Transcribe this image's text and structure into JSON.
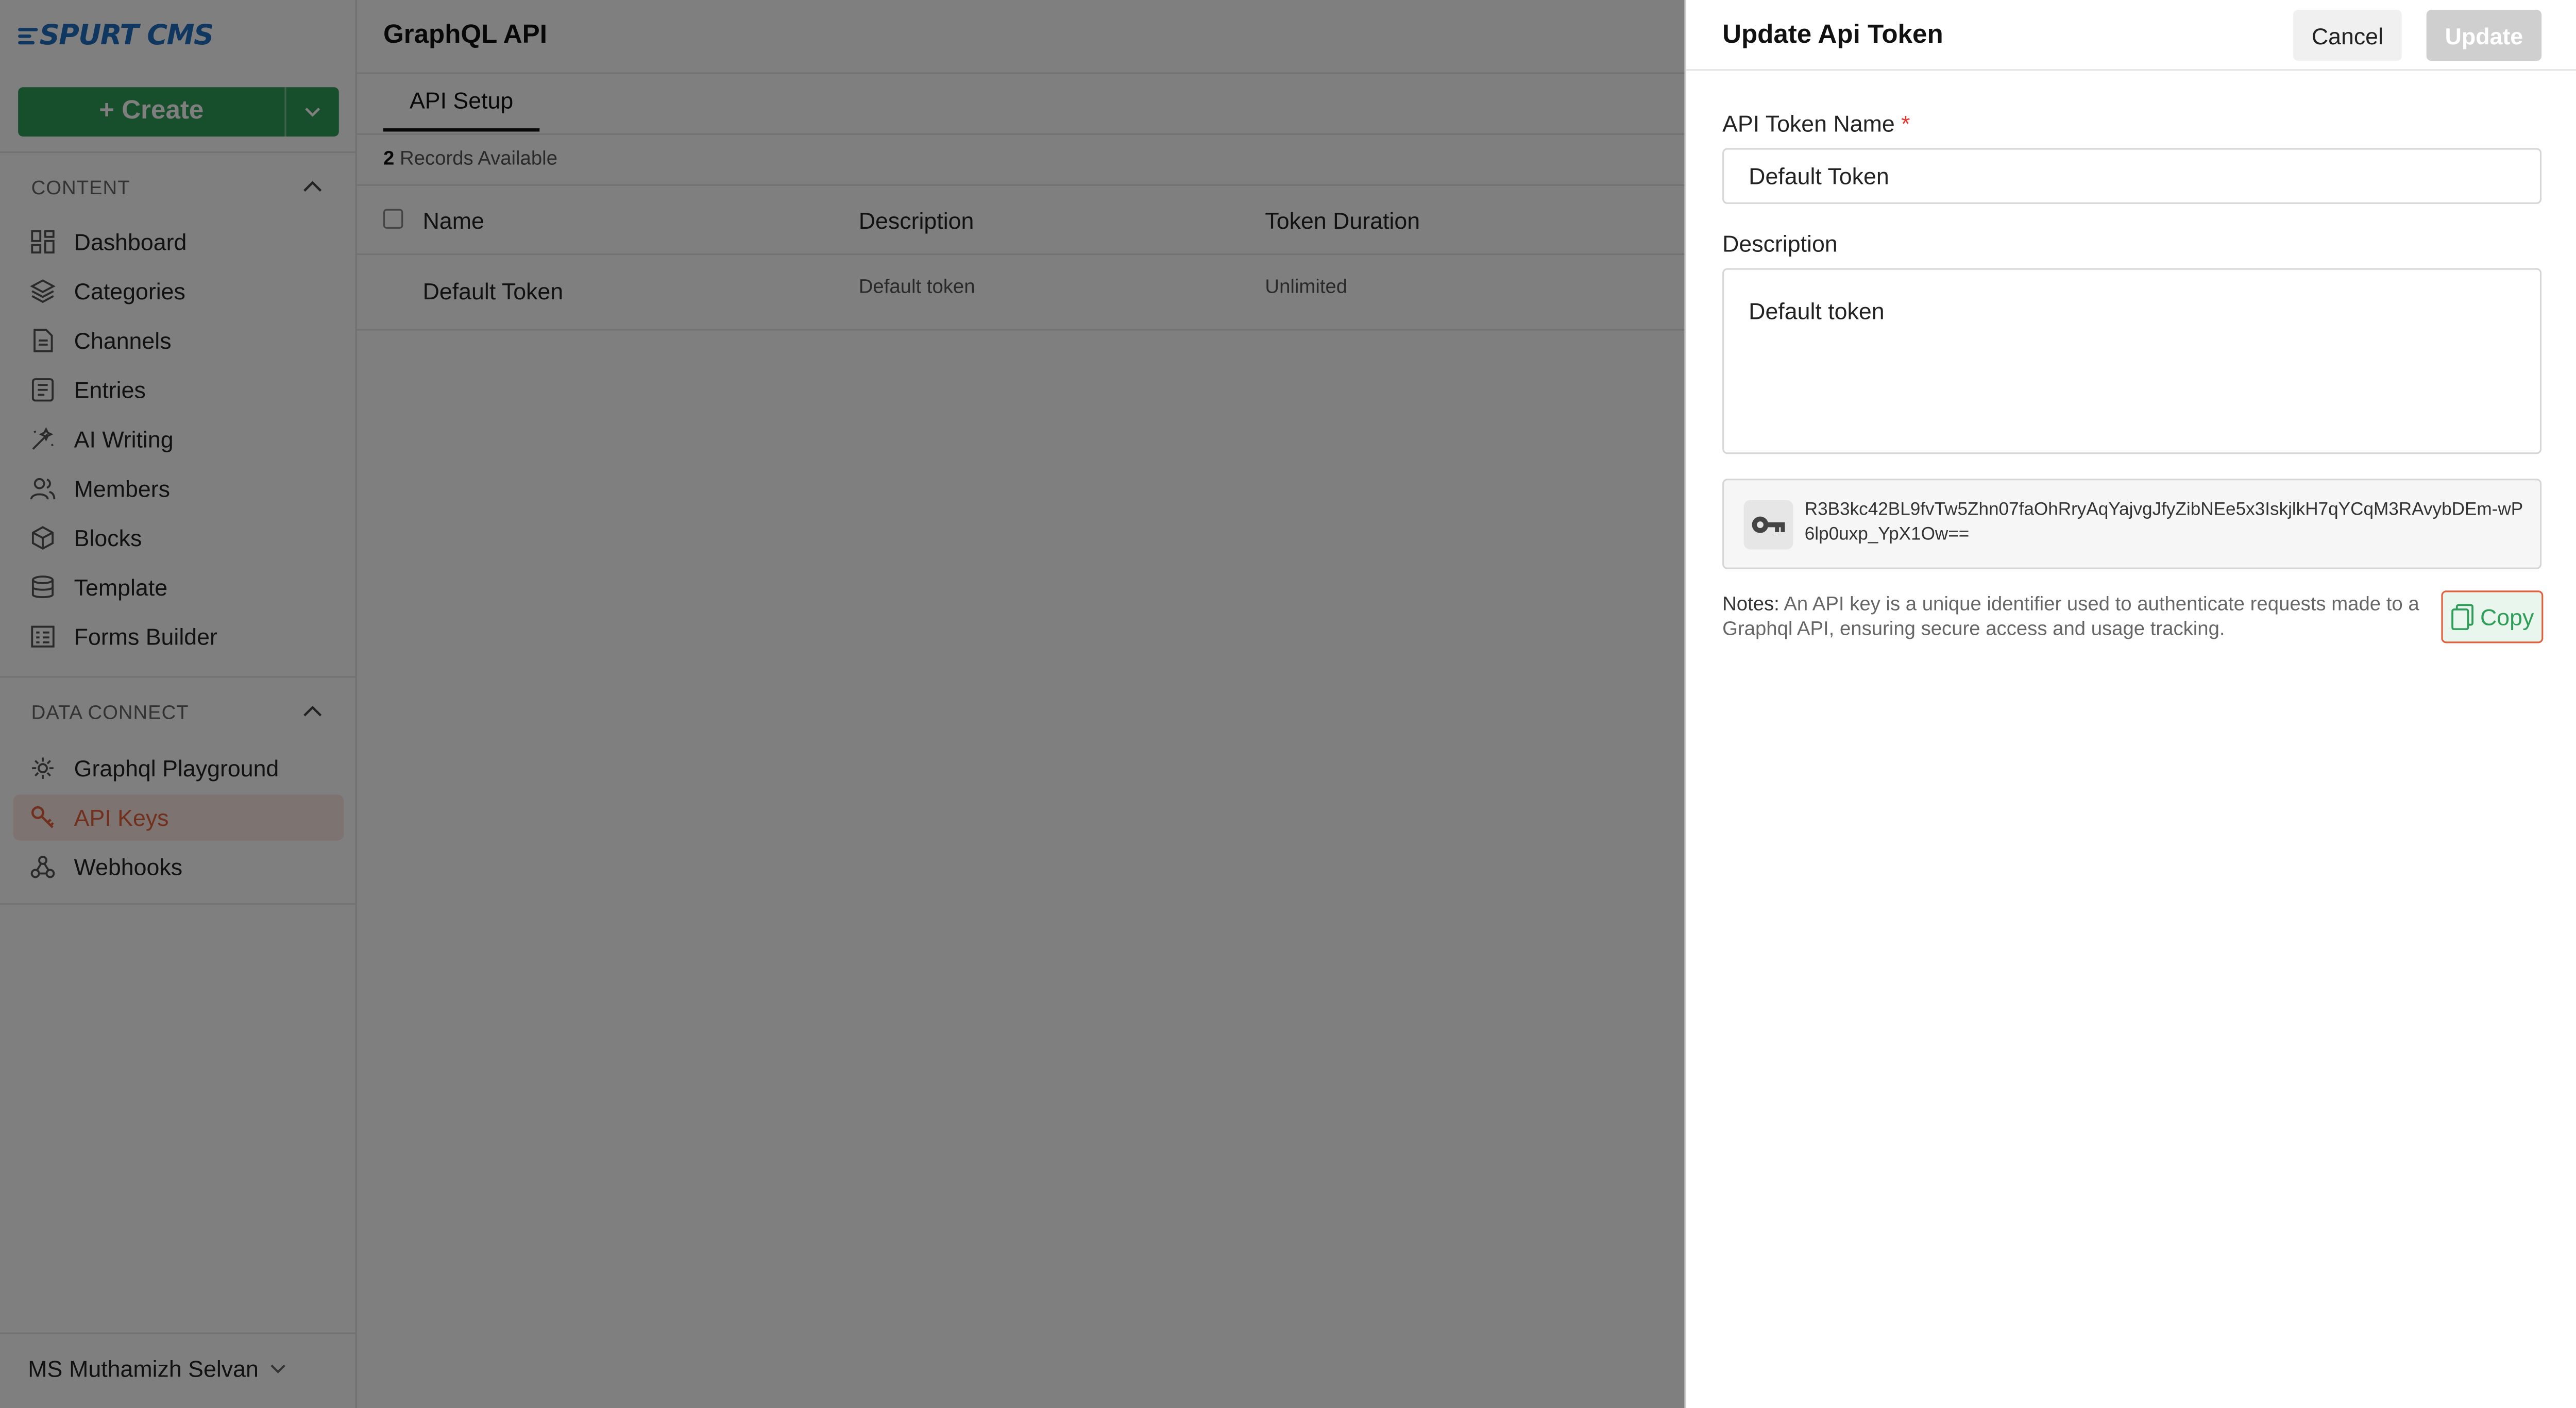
{
  "app": {
    "logo": "SPURT CMS"
  },
  "sidebar": {
    "create_label": "+ Create",
    "content_header": "CONTENT",
    "content_items": [
      {
        "label": "Dashboard",
        "icon": "dashboard-icon"
      },
      {
        "label": "Categories",
        "icon": "layers-icon"
      },
      {
        "label": "Channels",
        "icon": "channels-icon"
      },
      {
        "label": "Entries",
        "icon": "entries-icon"
      },
      {
        "label": "AI Writing",
        "icon": "magic-wand-icon"
      },
      {
        "label": "Members",
        "icon": "members-icon"
      },
      {
        "label": "Blocks",
        "icon": "blocks-icon"
      },
      {
        "label": "Template",
        "icon": "template-icon"
      },
      {
        "label": "Forms Builder",
        "icon": "forms-icon"
      }
    ],
    "data_header": "DATA CONNECT",
    "data_items": [
      {
        "label": "Graphql Playground",
        "icon": "graphql-icon"
      },
      {
        "label": "API Keys",
        "icon": "key-icon",
        "active": true
      },
      {
        "label": "Webhooks",
        "icon": "webhook-icon"
      }
    ],
    "user": {
      "initials": "MS",
      "name": "Muthamizh Selvan"
    }
  },
  "main": {
    "title": "GraphQL API",
    "tab": "API Setup",
    "records_count": "2",
    "records_text": "Records Available",
    "columns": [
      "Name",
      "Description",
      "Token Duration"
    ],
    "rows": [
      {
        "name": "Default Token",
        "description": "Default token",
        "duration": "Unlimited"
      }
    ]
  },
  "panel": {
    "title": "Update Api Token",
    "cancel_label": "Cancel",
    "update_label": "Update",
    "name_label": "API Token Name",
    "required_mark": "*",
    "name_value": "Default Token",
    "description_label": "Description",
    "description_value": "Default token",
    "api_key": "R3B3kc42BL9fvTw5Zhn07faOhRryAqYajvgJfyZibNEe5x3IskjlkH7qYCqM3RAvybDEm-wP6lp0uxp_YpX1Ow==",
    "notes_label": "Notes:",
    "notes_text": "An API key is a unique identifier used to authenticate requests made to a Graphql API, ensuring secure access and usage tracking.",
    "copy_label": "Copy"
  },
  "colors": {
    "brand": "#1e6fbf",
    "primary_green": "#2e9d57",
    "accent_orange": "#e35f3b"
  }
}
